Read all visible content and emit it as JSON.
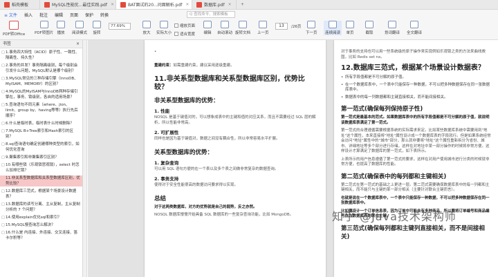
{
  "tabs": [
    {
      "label": "稻壳模板",
      "color": "#e24a3b"
    },
    {
      "label": "MySQL性能优...最佳实践.pdf",
      "color": "#e24a3b"
    },
    {
      "label": "BAT面试的20...问面解析.pdf",
      "color": "#e24a3b",
      "active": true
    },
    {
      "label": "数据库.pdf",
      "color": "#e24a3b"
    }
  ],
  "menu": {
    "home": "≡ 文件",
    "items": [
      "插入",
      "批注",
      "编辑",
      "页面",
      "保护",
      "转换"
    ],
    "search": "Q 查找命令、搜索模板"
  },
  "ribbon": {
    "buttons": [
      "PDF转Office",
      "PDF转图片",
      "播放",
      "阅读模式",
      "旋转",
      "放大",
      "实际大小",
      "适合页面",
      "编辑",
      "自动滚动",
      "缩放",
      "旋转文档",
      "单页",
      "双页",
      "连续阅读",
      "上一页",
      "下一页",
      "连续阅读",
      "截取",
      "划词翻译",
      "全文翻译"
    ],
    "zoom": "77.69%",
    "page_current": "13",
    "page_total": "/26页",
    "checks": [
      "缩放页面",
      "适合宽度",
      "显示所有页"
    ]
  },
  "sidebar": {
    "title": "书签",
    "items": [
      "1.事务四大特性（ACID）原子性、一致性、隔离性、持久性？",
      "2.事务的并发？事务隔离级别，每个级别会引发什么问题，MySQL默认是哪个级别？",
      "3.MySQL常见的三种存储引擎（InnoDB、MyISAM、MEMORY）的区别？",
      "4.MySQL的MyISAM与InnoDB两种存储引擎在，事务、锁级别，各自的适用场景？",
      "5.查询语句不同元素（where、jion、limit、group by、having等等）执行先后顺序？",
      "6.什么是临时表，临时表什么时候删除？",
      "7.MySQL B+Tree索引和Hash索引的区别？",
      "8.sql查询语句确定创建哪种类型的索引，如何优化查询",
      "9.聚集索引和非聚集索引区别？",
      "10.有哪些锁（乐观锁悲观锁），select 时怎么加排它锁？",
      "11.非关系型数据库和关系型数据库区别，优势比较？",
      "12.数据库三范式，根据某个场景设计数据表？",
      "13.数据库的读写分离、主从复制，主从复制分析的 7 个问题？",
      "14.使用explain优化sql和索引？",
      "15.MySQL慢查询怎么解决？",
      "16.什么是 内连接、外连接、交叉连接、笛卡尔积等？"
    ],
    "active_index": 10
  },
  "page_left": {
    "bullet_top": "•",
    "note_label": "重建约束：",
    "note_text": "如需重建约束，建议采用逐级重建。",
    "h1": "11.非关系型数据库和关系型数据库区别，优势比较？",
    "h2a": "非关系型数据库的优势：",
    "s1": "1. 性能",
    "s1_text": "NOSQL 是基于键值对的，可以想象成表中的主键和值的对应关系，而且不需要经过 SQL 层的解析，所以性能非常高。",
    "s2": "2. 可扩展性",
    "s2_text": "同样也是因为基于键值对，数据之间没有耦合性，所以非常容易水平扩展。",
    "h2b": "关系型数据库的优势：",
    "s3": "1. 复杂查询",
    "s3_text": "可以用 SQL 语句方便的在一个表以及多个表之间做非常复杂的数据查询。",
    "s4": "2. 事务支持",
    "s4_text": "使得对于安全性能很高的数据访问要求得以实现。",
    "h2c": "总结",
    "summary_bold": "对于这两类数据库，对方的优势就是自己的弱势，反之亦然。",
    "summary_text": "NOSQL 数据库慢慢开始具备 SQL 数据库的一些复杂查询功能，比如 MongoDB。"
  },
  "page_right": {
    "intro": "对于事务的支持也可以用一些系统级的原子操作来实现例如乐观锁之类的方法来曲线救国，比如 Redis set nx。",
    "h1": "12.数据库三范式，根据某个场景设计数据表？",
    "bullets": [
      "所有字段值都是不可分解的原子值。",
      "在一个数据库表中，一个表中只能保存一种数据，不可以把多种数据保存在同一张数据库表中。",
      "数据表中的每一列数据都和主键直接相关，而不能间接相关。"
    ],
    "h2a": "第一范式(确保每列保持原子性)",
    "nf1_bold": "第一范式是最基本的范式。如果数据库表中的所有字段值都是不可分解的原子值，就说明该数据库表满足了第一范式。",
    "nf1_text": "第一范式的合理遵循需要根据系统的实际需求来定。比如某些数据库系统中需要用到\"地址\"这个属性，本来直接将\"地址\"属性设计成一个数据库表的字段就行。但是如果系统经常会访问\"地址\"属性中的\"城市\"部分，那么就非要将\"地址\"这个属性重新拆分为省份、城市、详细地址等多个部分进行存储，这样在对地址中某一部分操作的时候将非常方便。这样设计才算满足了数据库的第一范式，如下表所示。",
    "nf1_text2": "上表所示的用户信息遵循了第一范式的要求，这样在对用户使用城市进行分类的时候就非常方便，也提高了数据库的性能。",
    "h2b": "第二范式(确保表中的每列都和主键相关)",
    "nf2_text": "第二范式在第一范式的基础之上更进一层。第二范式需要确保数据库表中的每一列都和主键相关，而不能只与主键的某一部分相关（主要针对联合主键而言）。",
    "nf2_bold": "也就是说在一个数据库表中，一个表中只能保存一种数据，不可以把多种数据保存在同一张数据库表中。",
    "nf2_text2": "比如要设计一个订单信息表，因为订单中可能会有多种商品，所以要将订单编号和商品编号作为数据库表的联合主键。",
    "h2c": "第三范式(确保每列都和主键列直接相关，而不是间接相关)"
  },
  "watermark": "知乎 @Java技术架构师"
}
